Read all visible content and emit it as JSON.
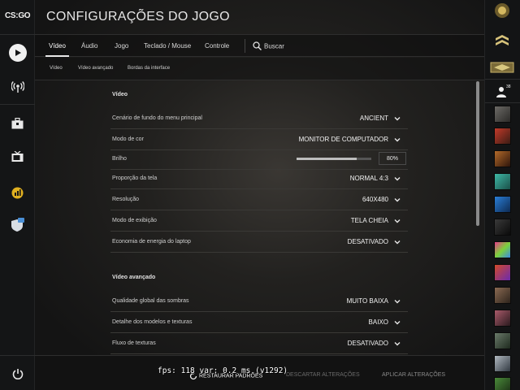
{
  "app": {
    "logo_text": "CS:GO"
  },
  "header": {
    "title": "CONFIGURAÇÕES DO JOGO"
  },
  "tabs": [
    {
      "label": "Vídeo",
      "active": true
    },
    {
      "label": "Áudio",
      "active": false
    },
    {
      "label": "Jogo",
      "active": false
    },
    {
      "label": "Teclado / Mouse",
      "active": false
    },
    {
      "label": "Controle",
      "active": false
    }
  ],
  "search": {
    "label": "Buscar"
  },
  "subtabs": [
    "Vídeo",
    "Vídeo avançado",
    "Bordas da interface"
  ],
  "sections": {
    "video": {
      "title": "Vídeo",
      "rows": [
        {
          "label": "Cenário de fundo do menu principal",
          "value": "ANCIENT"
        },
        {
          "label": "Modo de cor",
          "value": "MONITOR DE COMPUTADOR"
        },
        {
          "label": "Brilho",
          "value": "80%",
          "level": 0.8
        },
        {
          "label": "Proporção da tela",
          "value": "NORMAL 4:3"
        },
        {
          "label": "Resolução",
          "value": "640X480"
        },
        {
          "label": "Modo de exibição",
          "value": "TELA CHEIA"
        },
        {
          "label": "Economia de energia do laptop",
          "value": "DESATIVADO"
        }
      ]
    },
    "advanced": {
      "title": "Vídeo avançado",
      "rows": [
        {
          "label": "Qualidade global das sombras",
          "value": "MUITO BAIXA"
        },
        {
          "label": "Detalhe dos modelos e texturas",
          "value": "BAIXO"
        },
        {
          "label": "Fluxo de texturas",
          "value": "DESATIVADO"
        }
      ]
    }
  },
  "footer": {
    "restore": "RESTAURAR PADRÕES",
    "discard": "DESCARTAR ALTERAÇÕES",
    "apply": "APLICAR ALTERAÇÕES"
  },
  "debug_overlay": "fps:   118 var:  0.2 ms  (v1292)",
  "friends": {
    "count": "38"
  },
  "colors": {
    "accent": "#4a8fd6",
    "text": "#d8d8d8",
    "bg": "#141516"
  }
}
